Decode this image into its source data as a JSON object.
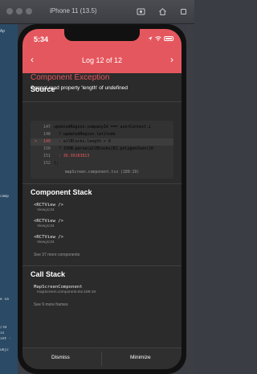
{
  "simulator": {
    "title": "iPhone 11 (13.5)",
    "icons": [
      "screenshot-icon",
      "home-icon",
      "rotate-icon"
    ]
  },
  "background": {
    "tab_text": "Ap",
    "code_snippets": [
      "comp",
      "e sa",
      "/TO",
      "is",
      "int -",
      "uhjc"
    ]
  },
  "status_bar": {
    "time": "5:34",
    "icons": [
      "location-icon",
      "wifi-icon",
      "battery-icon"
    ]
  },
  "header": {
    "title": "Log 12 of 12",
    "prev_label": "‹",
    "next_label": "›",
    "error_title": "Component Exception",
    "error_message": "Cannot read property 'length' of undefined",
    "accent_color": "#e5575e"
  },
  "source": {
    "heading": "Source",
    "lines": [
      {
        "number": "147",
        "text": "updatedRegion.companyId === userContext.i",
        "active": false
      },
      {
        "number": "148",
        "text": "? updatedRegion.latitude",
        "active": false
      },
      {
        "number": "149",
        "text": ": allBlocks.length > 0",
        "active": true
      },
      {
        "number": "150",
        "text": "? JSON.parse(allBlocks[0].polygonJson)[0",
        "active": false
      },
      {
        "number": "151",
        "text": ": 36.99183813",
        "active": false
      },
      {
        "number": "152",
        "text": ");",
        "active": false
      }
    ],
    "file_ref": "mapScreen.component.tsx (189:19)"
  },
  "component_stack": {
    "heading": "Component Stack",
    "frames": [
      {
        "component": "<RCTView />",
        "file": "View.js:34"
      },
      {
        "component": "<RCTView />",
        "file": "View.js:34"
      },
      {
        "component": "<RCTView />",
        "file": "View.js:34"
      }
    ],
    "see_more": "See 37 more components"
  },
  "call_stack": {
    "heading": "Call Stack",
    "frames": [
      {
        "component": "MapScreenComponent",
        "file": "mapScreen.component.tsx:189:19"
      }
    ],
    "see_more": "See 9 more frames"
  },
  "footer": {
    "dismiss_label": "Dismiss",
    "minimize_label": "Minimize"
  }
}
